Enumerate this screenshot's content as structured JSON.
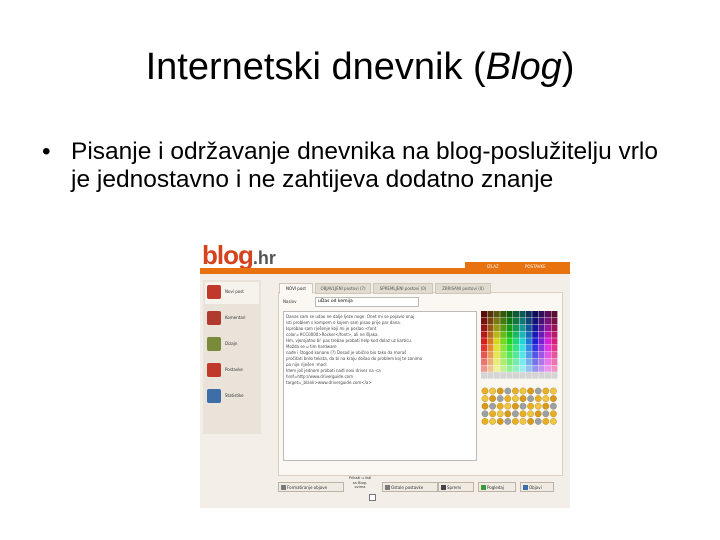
{
  "slide": {
    "title_prefix": "Internetski dnevnik (",
    "title_italic": "Blog",
    "title_suffix": ")",
    "bullet_symbol": "•",
    "bullet_text": "Pisanje i održavanje dnevnika na blog-poslužitelju vrlo je jednostavno i ne zahtijeva dodatno znanje"
  },
  "screenshot": {
    "logo": "blog",
    "logo_domain": ".hr",
    "topnav": [
      "IZLAZ",
      "POSTAVKE"
    ],
    "sidebar": [
      {
        "label": "Novi post",
        "color": "#c0392b"
      },
      {
        "label": "Komentari",
        "color": "#b03a2e"
      },
      {
        "label": "Dizajn",
        "color": "#7a8a3a"
      },
      {
        "label": "Postavke",
        "color": "#c0392b"
      },
      {
        "label": "Statistike",
        "color": "#3d6ea8"
      }
    ],
    "tabs": [
      "NOVI post",
      "OBJAVLJENI postovi (7)",
      "SPREMLJENI postovi (0)",
      "ZBRISANI postovi (0)"
    ],
    "title_label": "Naslov",
    "title_value": "uDas od kemija",
    "editor_lines": [
      "Danas sam se udao ne dalje ljeze noge. Onet mi se pojavio onaj",
      "isti problem s kompem o kojem sam pisao prije par dana.",
      "Isprobao sam rješenje koji mi je poslao <font",
      "color=#CC0000>Rocker</font>, ali ne šljaka.",
      "Hm, vjerojatno bi' pas trebao probati help kod dolaz uz karticu.",
      "Možda se u tim hardware",
      "nađe i štogod konane (?) Dosad je obično bio tako da moraš",
      "pročitati brdo teksta, da bi na kraju došao do problem koj te zanima",
      "pa nije riješen :mad:",
      "Idem još jednom probati nađi novi driver na <a",
      "href=http://www.driverguide.com",
      "target=_blank>www.driverguide.com</a>"
    ],
    "bottom": {
      "format_button": "Formatiranje objave",
      "publish_label": "Prikaži u listi sa Blog-ovima",
      "settings_button": "Ostale postavke",
      "save_button": "Spremi",
      "preview_button": "Pogledaj",
      "publish_button": "Objavi"
    }
  }
}
